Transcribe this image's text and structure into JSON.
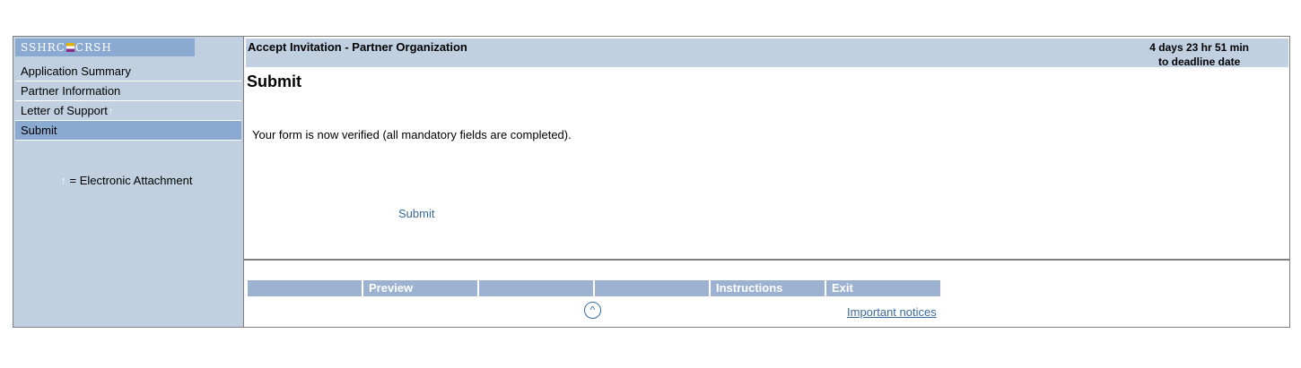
{
  "sidebar": {
    "logo": {
      "left": "SSHRC",
      "right": "CRSH"
    },
    "items": [
      {
        "label": "Application Summary"
      },
      {
        "label": "Partner Information"
      },
      {
        "label": "Letter of Support",
        "has_attachment": true
      },
      {
        "label": "Submit",
        "active": true
      }
    ],
    "legend": "= Electronic Attachment"
  },
  "header": {
    "title": "Accept Invitation - Partner Organization",
    "deadline_line1": "4 days 23 hr 51 min",
    "deadline_line2": "to deadline date"
  },
  "main": {
    "page_title": "Submit",
    "verify_message": "Your form is now verified (all mandatory fields are completed).",
    "submit_label": "Submit"
  },
  "toolbar": {
    "items": [
      "",
      "Preview",
      "",
      "",
      "Instructions",
      "Exit"
    ]
  },
  "footer": {
    "top_icon": "^",
    "notices_label": "Important notices"
  },
  "colors": {
    "sidebar_bg": "#c0d0e0",
    "active_bg": "#8aaad2",
    "toolbar_bg": "#9cb2d0",
    "link": "#3a6a9a"
  },
  "icons": {
    "attachment": "up-arrow-attachment-icon",
    "back_to_top": "caret-up-circle-icon"
  }
}
